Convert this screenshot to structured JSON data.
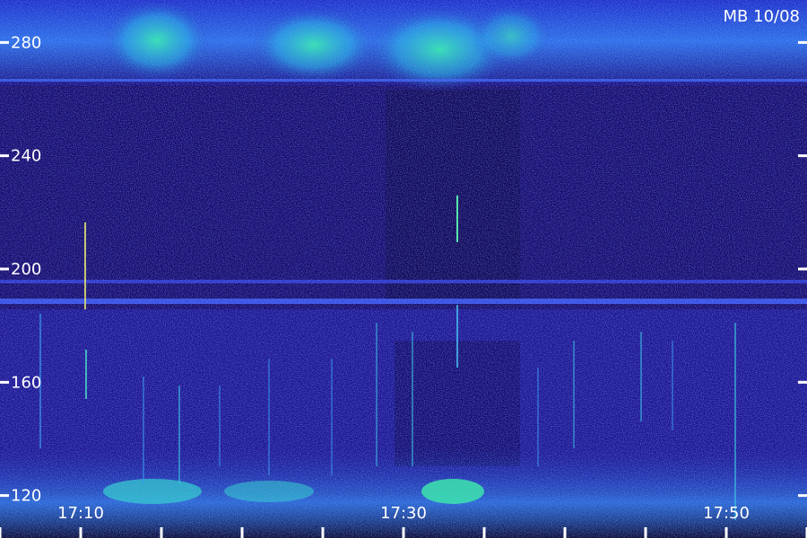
{
  "chart_data": {
    "type": "heatmap",
    "title": "MB 10/08",
    "xlabel": "",
    "ylabel": "",
    "y_ticks": [
      {
        "value": 280,
        "label": "280"
      },
      {
        "value": 240,
        "label": "240"
      },
      {
        "value": 200,
        "label": "200"
      },
      {
        "value": 160,
        "label": "160"
      },
      {
        "value": 120,
        "label": "120"
      }
    ],
    "x_ticks": [
      {
        "value": "17:10",
        "label": "17:10"
      },
      {
        "value": "17:30",
        "label": "17:30"
      },
      {
        "value": "17:50",
        "label": "17:50"
      }
    ],
    "x_range": [
      "17:05",
      "17:55"
    ],
    "y_range": [
      105,
      295
    ],
    "colormap": [
      "#000010",
      "#14086e",
      "#2a1fb4",
      "#3a4df0",
      "#2fb8f0",
      "#1cf0a0"
    ]
  }
}
